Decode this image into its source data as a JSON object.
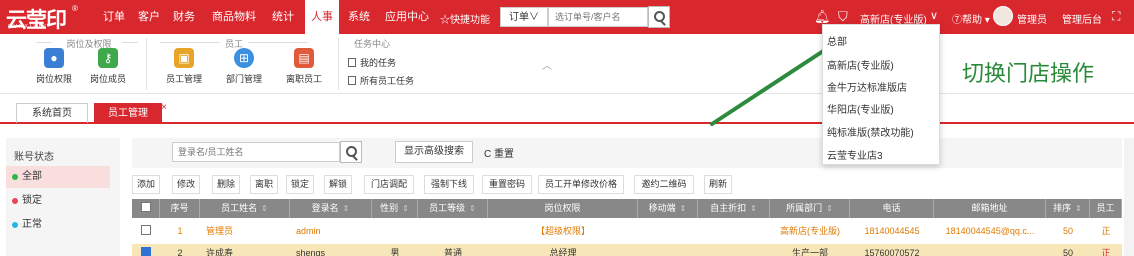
{
  "app": {
    "logo_main": "云莹印",
    "logo_sub": "YUNXIYIN",
    "logo_reg": "®"
  },
  "nav": {
    "items": [
      "订单",
      "客户",
      "财务",
      "商品物料",
      "统计",
      "人事",
      "系统",
      "应用中心"
    ],
    "active": "人事",
    "fast_function": "☆快捷功能"
  },
  "top_search": {
    "type_selected": "订单∨",
    "placeholder": "选订单号/客户名"
  },
  "top_right": {
    "store": "高新店(专业版)",
    "store_caret": "∨",
    "help": "⑦帮助 ▾",
    "user": "管理员",
    "admin_link": "管理后台"
  },
  "ribbon": {
    "groups": [
      {
        "title": "岗位及权限"
      },
      {
        "title": "员工"
      },
      {
        "title": "任务中心"
      }
    ],
    "buttons": [
      "岗位权限",
      "岗位成员",
      "员工管理",
      "部门管理",
      "离职员工"
    ],
    "tasks": [
      "我的任务",
      "所有员工任务"
    ],
    "collapse": "︿"
  },
  "annotation": "切换门店操作",
  "tabs": [
    {
      "label": "系统首页"
    },
    {
      "label": "员工管理",
      "close": "×"
    }
  ],
  "filter": {
    "title": "账号状态",
    "options": [
      {
        "label": "全部",
        "color": "#2eb84a"
      },
      {
        "label": "锁定",
        "color": "#e8475a"
      },
      {
        "label": "正常",
        "color": "#26b6e6"
      }
    ]
  },
  "search_panel": {
    "placeholder": "登录名/员工姓名",
    "advanced": "显示高级搜索",
    "reset": "C 重置"
  },
  "toolbar": [
    "添加",
    "修改",
    "删除",
    "离职",
    "锁定",
    "解锁",
    "门店调配",
    "强制下线",
    "重置密码",
    "员工开单修改价格",
    "邀约二维码",
    "刷新"
  ],
  "table": {
    "columns": [
      "",
      "序号",
      "员工姓名",
      "登录名",
      "性别",
      "员工等级",
      "岗位权限",
      "移动端",
      "自主折扣",
      "所属部门",
      "电话",
      "邮箱地址",
      "排序",
      "员工"
    ],
    "sort_icon": "⇕",
    "rows": [
      [
        "",
        "1",
        "管理员",
        "admin",
        "",
        "",
        "【超级权限】",
        "",
        "",
        "高新店(专业版)",
        "18140044545",
        "18140044545@qq.c...",
        "50",
        "正"
      ],
      [
        "",
        "2",
        "许成寿",
        "shengs",
        "男",
        "普通",
        "总经理",
        "",
        "",
        "生产一部",
        "15760070572",
        "",
        "50",
        "正"
      ]
    ]
  },
  "dropdown": {
    "items": [
      "总部",
      "高新店(专业版)",
      "金牛万达标准版店",
      "华阳店(专业版)",
      "纯标准版(禁改功能)",
      "云莹专业店3"
    ]
  },
  "colors": {
    "brand": "#d9272e",
    "annotation": "#2a8a3a"
  }
}
